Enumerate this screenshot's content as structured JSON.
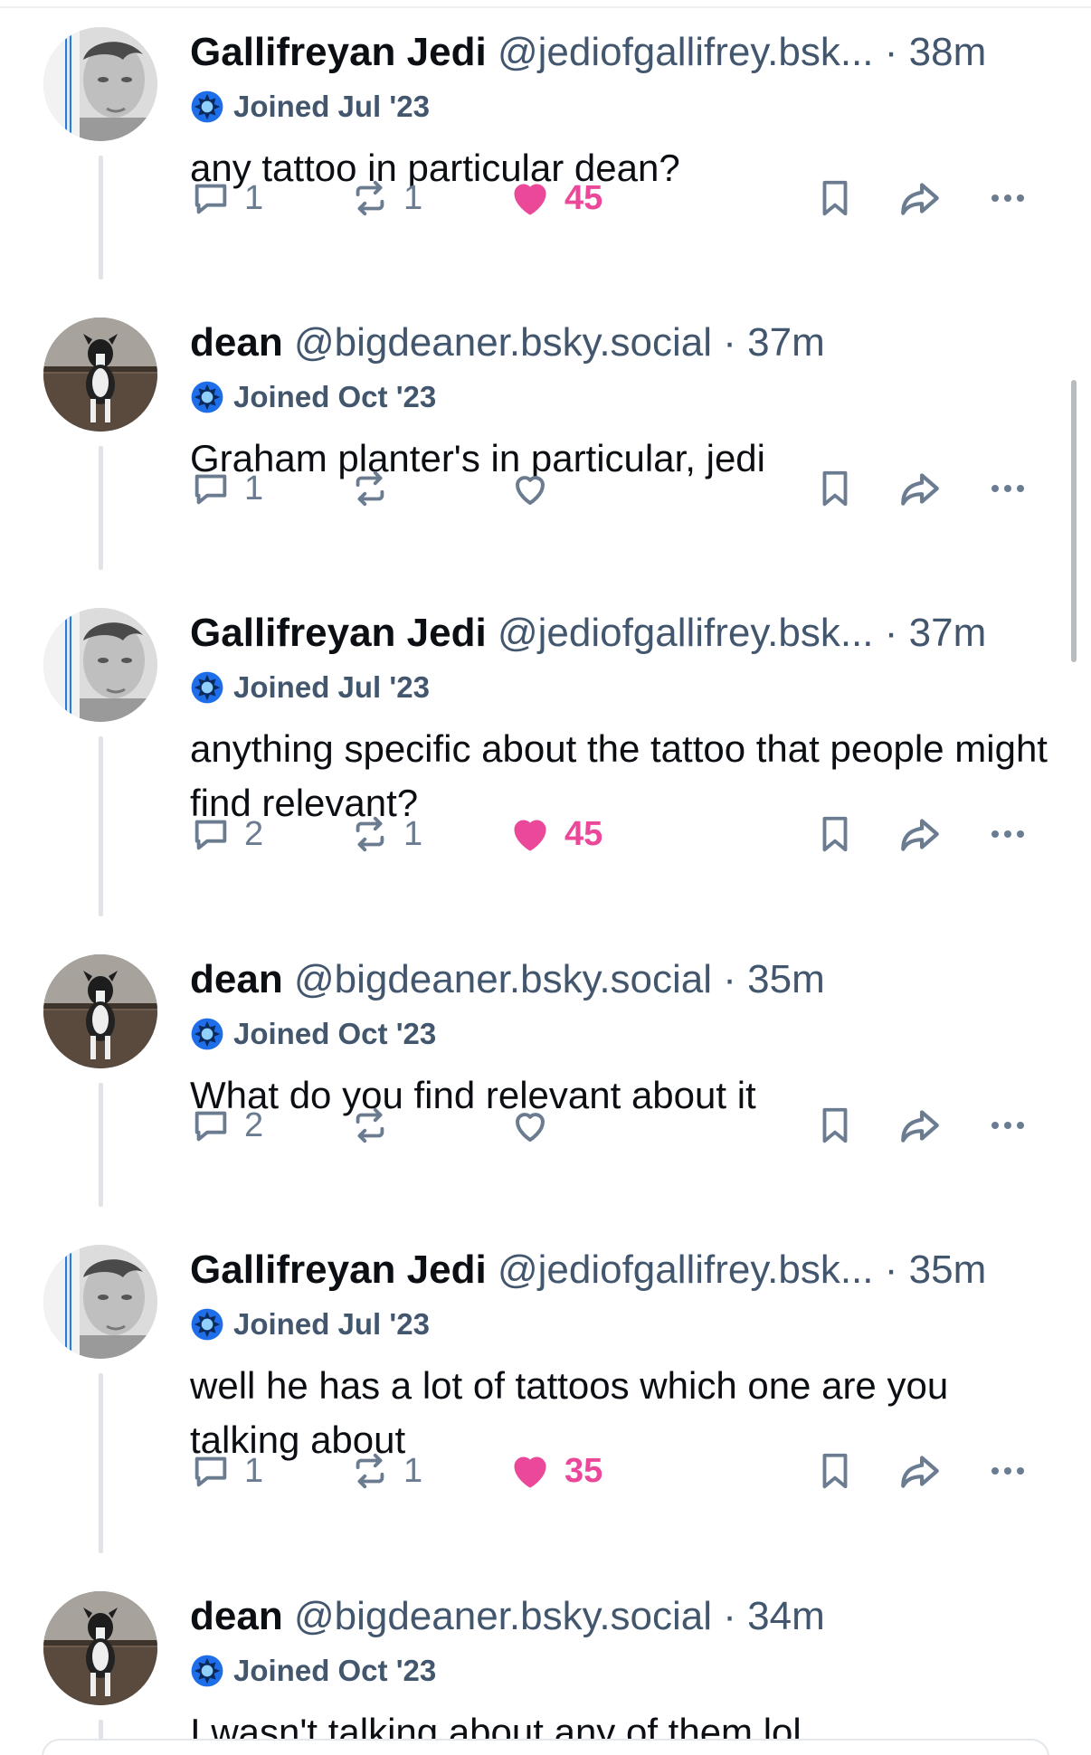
{
  "posts": [
    {
      "display_name": "Gallifreyan Jedi",
      "handle": "@jediofgallifrey.bsk...",
      "dot": "·",
      "time": "38m",
      "joined": "Joined Jul '23",
      "text": "any tattoo in particular dean?",
      "avatar": "avatar-jedi",
      "reply_count": "1",
      "repost_count": "1",
      "like_count": "45",
      "liked": true
    },
    {
      "display_name": "dean",
      "handle": "@bigdeaner.bsky.social",
      "dot": "·",
      "time": "37m",
      "joined": "Joined Oct '23",
      "text": "Graham planter's in particular, jedi",
      "avatar": "avatar-dog",
      "reply_count": "1",
      "repost_count": "",
      "like_count": "",
      "liked": false
    },
    {
      "display_name": "Gallifreyan Jedi",
      "handle": "@jediofgallifrey.bsk...",
      "dot": "·",
      "time": "37m",
      "joined": "Joined Jul '23",
      "text": "anything specific about the tattoo that people might find relevant?",
      "avatar": "avatar-jedi",
      "reply_count": "2",
      "repost_count": "1",
      "like_count": "45",
      "liked": true
    },
    {
      "display_name": "dean",
      "handle": "@bigdeaner.bsky.social",
      "dot": "·",
      "time": "35m",
      "joined": "Joined Oct '23",
      "text": "What do you find relevant about it",
      "avatar": "avatar-dog",
      "reply_count": "2",
      "repost_count": "",
      "like_count": "",
      "liked": false
    },
    {
      "display_name": "Gallifreyan Jedi",
      "handle": "@jediofgallifrey.bsk...",
      "dot": "·",
      "time": "35m",
      "joined": "Joined Jul '23",
      "text": "well he has a lot of tattoos which one are you talking about",
      "avatar": "avatar-jedi",
      "reply_count": "1",
      "repost_count": "1",
      "like_count": "35",
      "liked": true
    },
    {
      "display_name": "dean",
      "handle": "@bigdeaner.bsky.social",
      "dot": "·",
      "time": "34m",
      "joined": "Joined Oct '23",
      "text": "I wasn't talking about any of them lol",
      "avatar": "avatar-dog",
      "reply_count": "",
      "repost_count": "",
      "like_count": "",
      "liked": false
    }
  ],
  "icons": {
    "reply": "reply-icon",
    "repost": "repost-icon",
    "like": "heart-icon",
    "bookmark": "bookmark-icon",
    "share": "share-icon",
    "more": "more-icon",
    "joined": "new-user-icon"
  },
  "colors": {
    "like_active": "#ec4899",
    "muted": "#42566e",
    "icon": "#6b7c91",
    "thread_line": "#dfe4ea",
    "joined_icon": "#1d6ee8"
  }
}
